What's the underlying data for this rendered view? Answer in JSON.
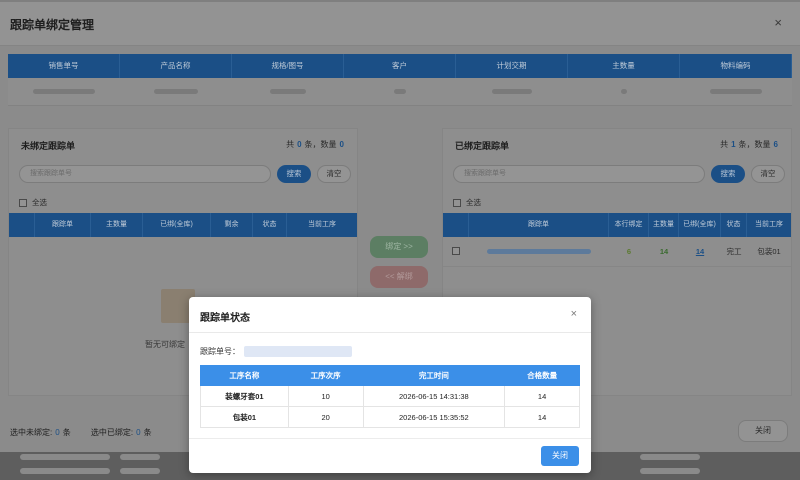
{
  "dialog": {
    "title": "跟踪单绑定管理",
    "close_glyph": "×"
  },
  "info_table": {
    "headers": [
      "销售单号",
      "产品名称",
      "规格/图号",
      "客户",
      "计划交期",
      "主数量",
      "物料编码"
    ]
  },
  "left_panel": {
    "title": "未绑定跟踪单",
    "count_prefix": "共",
    "count_total": "0",
    "count_mid": "条，数量",
    "count_qty": "0",
    "search_placeholder": "搜索跟踪单号",
    "search_label": "搜索",
    "clear_label": "清空",
    "select_all_label": "全选",
    "columns": [
      "跟踪单",
      "主数量",
      "已绑(全库)",
      "剩余",
      "状态",
      "当前工序"
    ],
    "empty_text": "暂无可绑定"
  },
  "middle": {
    "bind_label": "绑定 >>",
    "unbind_label": "<< 解绑"
  },
  "right_panel": {
    "title": "已绑定跟踪单",
    "count_prefix": "共",
    "count_total": "1",
    "count_mid": "条，数量",
    "count_qty": "6",
    "search_placeholder": "搜索跟踪单号",
    "search_label": "搜索",
    "clear_label": "清空",
    "select_all_label": "全选",
    "columns": [
      "跟踪单",
      "本行绑定",
      "主数量",
      "已绑(全库)",
      "状态",
      "当前工序"
    ],
    "rows": [
      {
        "row_bind": "6",
        "main_qty": "14",
        "bound_all": "14",
        "status": "完工",
        "process": "包装01"
      }
    ]
  },
  "footer": {
    "selected_unbound_label": "选中未绑定:",
    "selected_unbound_count": "0",
    "selected_unbound_unit": "条",
    "selected_bound_label": "选中已绑定:",
    "selected_bound_count": "0",
    "selected_bound_unit": "条",
    "close_label": "关闭"
  },
  "status_modal": {
    "title": "跟踪单状态",
    "close_glyph": "×",
    "tracking_label": "跟踪单号：",
    "columns": [
      "工序名称",
      "工序次序",
      "完工时间",
      "合格数量"
    ],
    "rows": [
      {
        "name": "装螺牙套01",
        "seq": "10",
        "time": "2026-06-15 14:31:38",
        "qty": "14"
      },
      {
        "name": "包装01",
        "seq": "20",
        "time": "2026-06-15 15:35:52",
        "qty": "14"
      }
    ],
    "close_label": "关闭"
  },
  "colors": {
    "primary": "#3b8fe8",
    "bind_green": "#5c7e63",
    "unbind_red": "#8e6a6a"
  }
}
